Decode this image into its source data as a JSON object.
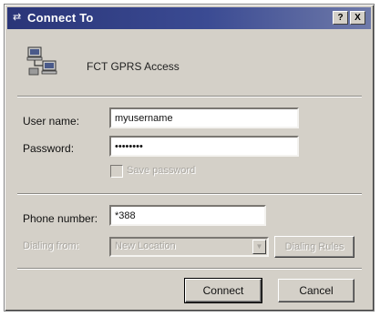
{
  "window": {
    "title": "Connect To",
    "title_icon": "network-icon",
    "help_label": "?",
    "close_label": "X"
  },
  "connection": {
    "icon": "dialup-computers-icon",
    "name": "FCT GPRS Access"
  },
  "form": {
    "user_name_label": "User name:",
    "user_name_value": "myusername",
    "password_label": "Password:",
    "password_value": "••••••••",
    "save_password_label": "Save password",
    "save_password_checked": false,
    "phone_number_label": "Phone number:",
    "phone_number_value": "*388",
    "dialing_from_label": "Dialing from:",
    "dialing_from_value": "New Location",
    "dialing_rules_label": "Dialing Rules"
  },
  "buttons": {
    "connect": "Connect",
    "cancel": "Cancel"
  }
}
